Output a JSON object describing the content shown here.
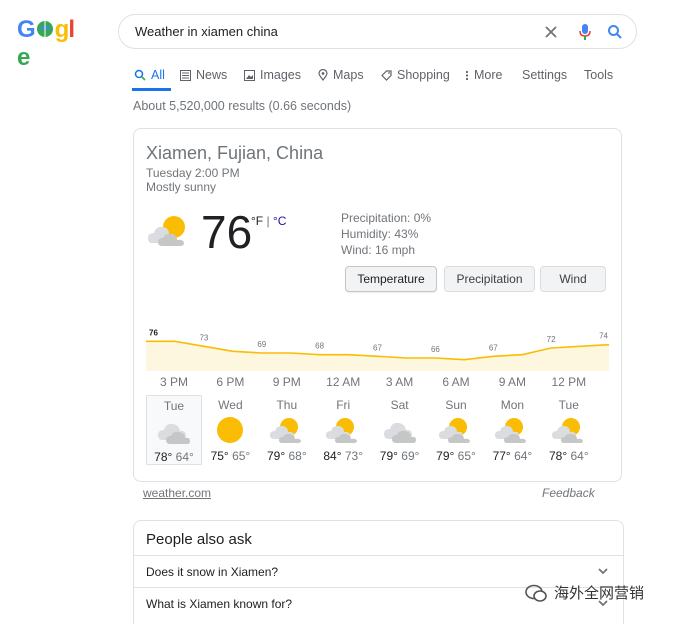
{
  "logo": "Google",
  "search": {
    "query": "Weather in xiamen china"
  },
  "tabs": [
    {
      "label": "All"
    },
    {
      "label": "News"
    },
    {
      "label": "Images"
    },
    {
      "label": "Maps"
    },
    {
      "label": "Shopping"
    },
    {
      "label": "More"
    },
    {
      "label": "Settings"
    },
    {
      "label": "Tools"
    }
  ],
  "result_stats": "About 5,520,000 results (0.66 seconds)",
  "weather": {
    "location": "Xiamen, Fujian, China",
    "time": "Tuesday 2:00 PM",
    "condition": "Mostly sunny",
    "temperature": "76",
    "unit_f": "°F",
    "unit_sep": "|",
    "unit_c": "°C",
    "precipitation": "Precipitation: 0%",
    "humidity": "Humidity: 43%",
    "wind": "Wind: 16 mph",
    "buttons": [
      "Temperature",
      "Precipitation",
      "Wind"
    ],
    "selected_button": "Temperature",
    "chart_data": {
      "type": "area",
      "x": [
        "3 PM",
        "6 PM",
        "9 PM",
        "12 AM",
        "3 AM",
        "6 AM",
        "9 AM",
        "12 PM"
      ],
      "hourly_temps": [
        76,
        76,
        73,
        70,
        69,
        69,
        68,
        68,
        67,
        66,
        66,
        65,
        67,
        68,
        72,
        73,
        74
      ],
      "labeled_points": [
        {
          "x": "3 PM",
          "y": 76
        },
        {
          "x": "6 PM",
          "y": 73
        },
        {
          "x": "9 PM",
          "y": 69
        },
        {
          "x": "12 AM",
          "y": 68
        },
        {
          "x": "3 AM",
          "y": 67
        },
        {
          "x": "6 AM",
          "y": 66
        },
        {
          "x": "9 AM",
          "y": 67
        },
        {
          "x": "12 PM",
          "y": 72
        },
        {
          "x": "end",
          "y": 74
        }
      ],
      "line_color": "#fbbc04",
      "fill_color": "#fef7e0"
    },
    "days": [
      {
        "name": "Tue",
        "icon": "cloudy-icon",
        "high": "78°",
        "low": "64°"
      },
      {
        "name": "Wed",
        "icon": "sunny-icon",
        "high": "75°",
        "low": "65°"
      },
      {
        "name": "Thu",
        "icon": "partly-cloudy-icon",
        "high": "79°",
        "low": "68°"
      },
      {
        "name": "Fri",
        "icon": "partly-cloudy-icon",
        "high": "84°",
        "low": "73°"
      },
      {
        "name": "Sat",
        "icon": "cloudy-icon",
        "high": "79°",
        "low": "69°"
      },
      {
        "name": "Sun",
        "icon": "partly-cloudy-icon",
        "high": "79°",
        "low": "65°"
      },
      {
        "name": "Mon",
        "icon": "partly-cloudy-icon",
        "high": "77°",
        "low": "64°"
      },
      {
        "name": "Tue",
        "icon": "partly-cloudy-icon",
        "high": "78°",
        "low": "64°"
      }
    ],
    "source": "weather.com",
    "feedback": "Feedback"
  },
  "people_also_ask": {
    "title": "People also ask",
    "questions": [
      "Does it snow in Xiamen?",
      "What is Xiamen known for?"
    ]
  },
  "watermark": "海外全网营销",
  "colors": {
    "accent": "#1a73e8",
    "sun": "#fbbc04",
    "cloud": "#c4c7c5"
  }
}
